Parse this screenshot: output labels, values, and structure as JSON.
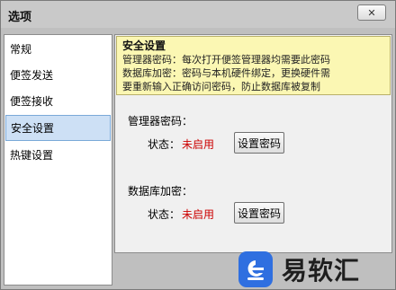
{
  "window": {
    "title": "选项",
    "close_symbol": "✕"
  },
  "sidebar": {
    "items": [
      {
        "label": "常规"
      },
      {
        "label": "便签发送"
      },
      {
        "label": "便签接收"
      },
      {
        "label": "安全设置"
      },
      {
        "label": "热键设置"
      }
    ],
    "selected": "安全设置"
  },
  "notice": {
    "title": "安全设置",
    "lines": [
      "管理器密码：每次打开便签管理器均需要此密码",
      "数据库加密：密码与本机硬件绑定，更换硬件需",
      "要重新输入正确访问密码，防止数据库被复制"
    ]
  },
  "manager_password": {
    "group_label": "管理器密码：",
    "status_label": "状态：",
    "status_value": "未启用",
    "button_label": "设置密码"
  },
  "db_encryption": {
    "group_label": "数据库加密：",
    "status_label": "状态：",
    "status_value": "未启用",
    "button_label": "设置密码"
  },
  "watermark": {
    "text": "易软汇",
    "logo_icon": "e-logo-icon"
  },
  "colors": {
    "window_bg": "#bfbfbf",
    "notice_bg": "#fbf7b3",
    "selected_bg": "#cde0f5",
    "status_disabled": "#cc0000",
    "logo": "#2f6fe0"
  }
}
